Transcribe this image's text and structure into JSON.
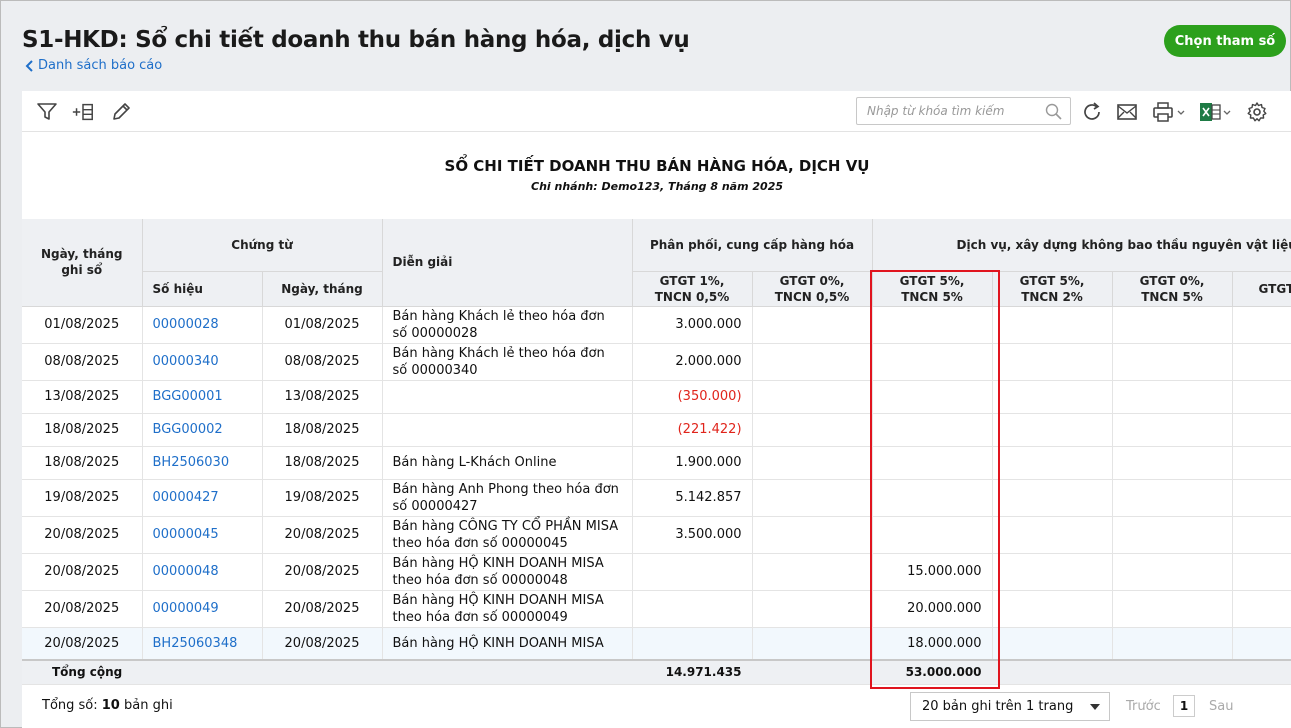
{
  "header": {
    "title": "S1-HKD: Sổ chi tiết doanh thu bán hàng hóa, dịch vụ",
    "back_label": "Danh sách báo cáo",
    "choose_button": "Chọn tham số"
  },
  "toolbar": {
    "search_placeholder": "Nhập từ khóa tìm kiếm"
  },
  "report": {
    "title": "SỔ CHI TIẾT DOANH THU BÁN HÀNG HÓA, DỊCH VỤ",
    "subtitle": "Chi nhánh: Demo123, Tháng 8 năm 2025"
  },
  "columns": {
    "date": "Ngày, tháng ghi sổ",
    "voucher": "Chứng từ",
    "voucher_no": "Số hiệu",
    "voucher_date": "Ngày, tháng",
    "description": "Diễn giải",
    "group_goods": "Phân phối, cung cấp hàng hóa",
    "group_service": "Dịch vụ, xây dựng không bao thầu nguyên vật liệu",
    "g1": "GTGT 1%, TNCN 0,5%",
    "g2": "GTGT 0%, TNCN 0,5%",
    "s1": "GTGT 5%, TNCN 5%",
    "s2": "GTGT 5%, TNCN 2%",
    "s3": "GTGT 0%, TNCN 5%",
    "s4": "GTGT TNCN"
  },
  "rows": [
    {
      "date": "01/08/2025",
      "no": "00000028",
      "vdate": "01/08/2025",
      "desc": "Bán hàng Khách lẻ theo hóa đơn số 00000028",
      "g1": "3.000.000",
      "s1": ""
    },
    {
      "date": "08/08/2025",
      "no": "00000340",
      "vdate": "08/08/2025",
      "desc": "Bán hàng Khách lẻ theo hóa đơn số 00000340",
      "g1": "2.000.000",
      "s1": ""
    },
    {
      "date": "13/08/2025",
      "no": "BGG00001",
      "vdate": "13/08/2025",
      "desc": "",
      "g1": "(350.000)",
      "s1": ""
    },
    {
      "date": "18/08/2025",
      "no": "BGG00002",
      "vdate": "18/08/2025",
      "desc": "",
      "g1": "(221.422)",
      "s1": ""
    },
    {
      "date": "18/08/2025",
      "no": "BH2506030",
      "vdate": "18/08/2025",
      "desc": "Bán hàng L-Khách Online",
      "g1": "1.900.000",
      "s1": ""
    },
    {
      "date": "19/08/2025",
      "no": "00000427",
      "vdate": "19/08/2025",
      "desc": "Bán hàng Anh Phong theo hóa đơn số 00000427",
      "g1": "5.142.857",
      "s1": ""
    },
    {
      "date": "20/08/2025",
      "no": "00000045",
      "vdate": "20/08/2025",
      "desc": "Bán hàng CÔNG TY CỔ PHẦN MISA theo hóa đơn số 00000045",
      "g1": "3.500.000",
      "s1": ""
    },
    {
      "date": "20/08/2025",
      "no": "00000048",
      "vdate": "20/08/2025",
      "desc": "Bán hàng HỘ KINH DOANH MISA theo hóa đơn số 00000048",
      "g1": "",
      "s1": "15.000.000"
    },
    {
      "date": "20/08/2025",
      "no": "00000049",
      "vdate": "20/08/2025",
      "desc": "Bán hàng HỘ KINH DOANH MISA theo hóa đơn số 00000049",
      "g1": "",
      "s1": "20.000.000"
    },
    {
      "date": "20/08/2025",
      "no": "BH25060348",
      "vdate": "20/08/2025",
      "desc": "Bán hàng HỘ KINH DOANH MISA",
      "g1": "",
      "s1": "18.000.000"
    }
  ],
  "total": {
    "label": "Tổng cộng",
    "g1": "14.971.435",
    "s1": "53.000.000"
  },
  "footer": {
    "count_prefix": "Tổng số:",
    "count_value": "10",
    "count_suffix": "bản ghi",
    "page_size": "20 bản ghi trên 1 trang",
    "prev": "Trước",
    "current_page": "1",
    "next": "Sau"
  },
  "colors": {
    "accent": "#2ca01c",
    "link": "#1f6fc9",
    "negative": "#e0241b",
    "highlight": "#e0141e"
  }
}
